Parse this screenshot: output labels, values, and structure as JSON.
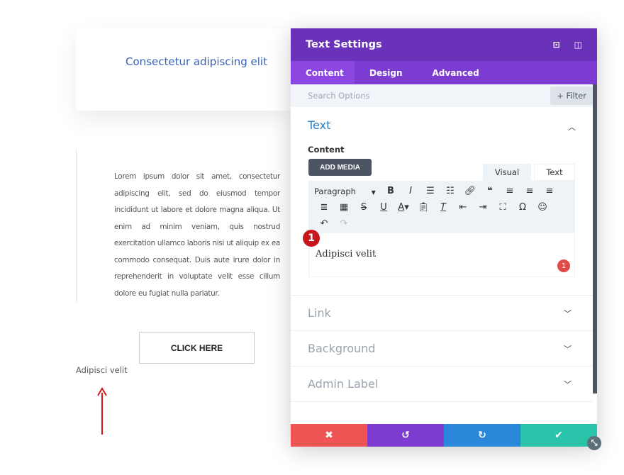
{
  "page": {
    "heading": "Consectetur adipiscing elit",
    "body": "Lorem ipsum dolor sit amet, consectetur adipiscing elit, sed do eiusmod tempor incididunt ut labore et dolore magna aliqua. Ut enim ad minim veniam, quis nostrud exercitation ullamco laboris nisi ut aliquip ex ea commodo consequat. Duis aute irure dolor in reprehenderit in voluptate velit esse cillum dolore eu fugiat nulla pariatur.",
    "button": "CLICK HERE",
    "preview_text": "Adipisci velit"
  },
  "modal": {
    "title": "Text Settings",
    "tabs": [
      "Content",
      "Design",
      "Advanced"
    ],
    "search_placeholder": "Search Options",
    "filter": "+ Filter",
    "section": "Text",
    "content_label": "Content",
    "add_media": "ADD MEDIA",
    "mode_tabs": [
      "Visual",
      "Text"
    ],
    "format": "Paragraph",
    "editor_text": "Adipisci velit",
    "step_badge": "1",
    "error_badge": "1",
    "rows": [
      "Link",
      "Background",
      "Admin Label"
    ]
  },
  "colors": {
    "header": "#6a32b8",
    "tabs": "#7c3bd1",
    "cancel": "#ef5555",
    "undo": "#7d3bcf",
    "redo": "#2b87da",
    "save": "#29c4a9"
  }
}
